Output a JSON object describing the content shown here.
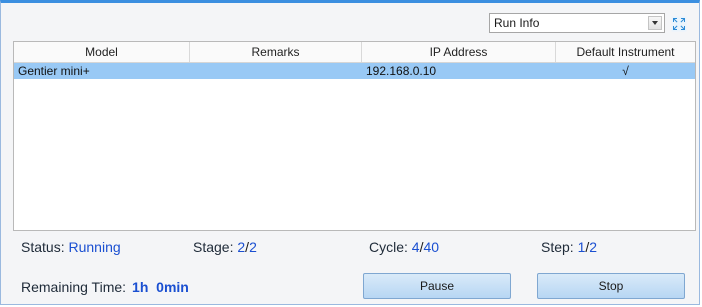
{
  "view_select": {
    "value": "Run Info"
  },
  "table": {
    "headers": [
      "Model",
      "Remarks",
      "IP Address",
      "Default Instrument"
    ],
    "rows": [
      {
        "model": "Gentier mini+",
        "remarks": "",
        "ip": "192.168.0.10",
        "default": "√"
      }
    ]
  },
  "status": {
    "status_label": "Status:",
    "status_value": "Running",
    "stage_label": "Stage:",
    "stage_current": "2",
    "stage_sep": "/",
    "stage_total": "2",
    "cycle_label": "Cycle:",
    "cycle_current": "4",
    "cycle_sep": "/",
    "cycle_total": "40",
    "step_label": "Step:",
    "step_current": "1",
    "step_sep": "/",
    "step_total": "2"
  },
  "remaining": {
    "label": "Remaining Time:",
    "value": "1h  0min"
  },
  "buttons": {
    "pause": "Pause",
    "stop": "Stop"
  },
  "colors": {
    "accent": "#3b8fe0",
    "selected_row": "#99c9f5",
    "value_blue": "#1a4fd1"
  }
}
